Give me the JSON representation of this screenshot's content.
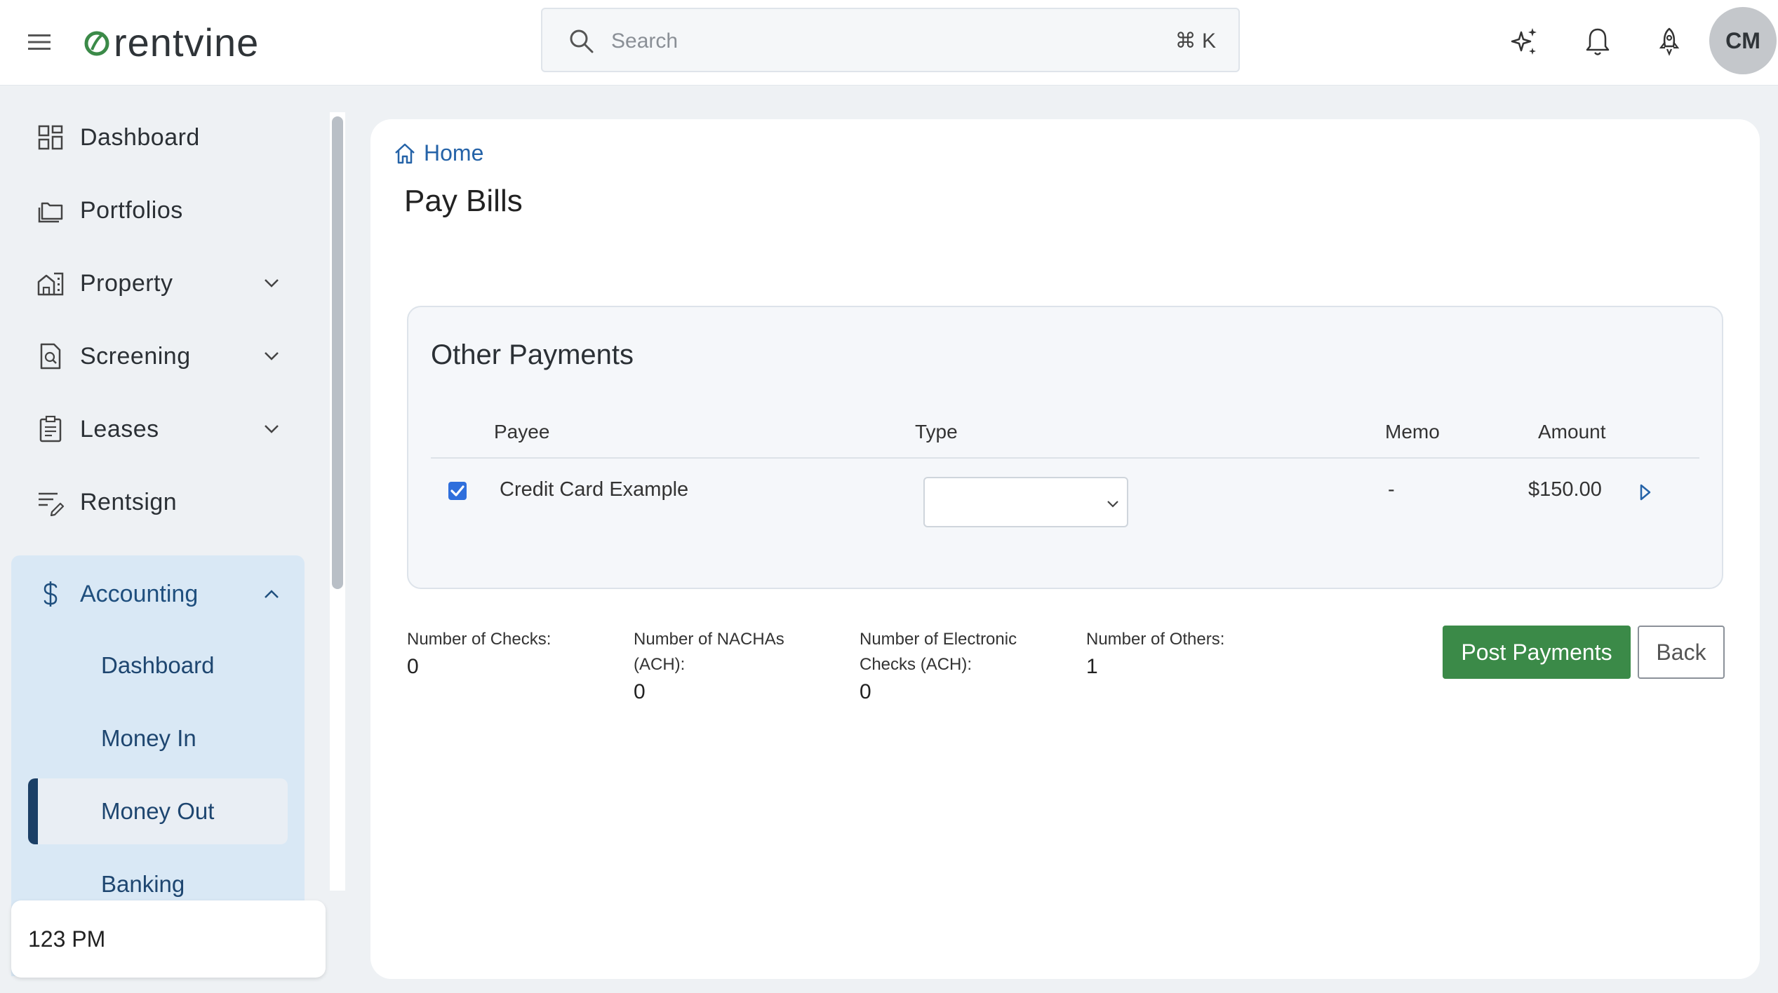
{
  "header": {
    "brand": "rentvine",
    "search_placeholder": "Search",
    "search_shortcut": "⌘ K",
    "avatar_initials": "CM"
  },
  "sidebar": {
    "items": [
      {
        "label": "Dashboard",
        "icon": "dashboard-grid-icon"
      },
      {
        "label": "Portfolios",
        "icon": "folders-icon"
      },
      {
        "label": "Property",
        "icon": "building-icon",
        "expandable": true
      },
      {
        "label": "Screening",
        "icon": "document-search-icon",
        "expandable": true
      },
      {
        "label": "Leases",
        "icon": "clipboard-icon",
        "expandable": true
      },
      {
        "label": "Rentsign",
        "icon": "signature-icon"
      }
    ],
    "accounting": {
      "label": "Accounting",
      "icon": "dollar-icon",
      "expanded": true,
      "sub_items": [
        "Dashboard",
        "Money In",
        "Money Out",
        "Banking"
      ],
      "active": "Money Out"
    },
    "org_name": "123 PM"
  },
  "main": {
    "breadcrumb": "Home",
    "title": "Pay Bills",
    "panel": {
      "title": "Other Payments",
      "columns": {
        "payee": "Payee",
        "type": "Type",
        "memo": "Memo",
        "amount": "Amount"
      },
      "rows": [
        {
          "checked": true,
          "payee": "Credit Card Example",
          "type": "",
          "memo": "-",
          "amount": "$150.00"
        }
      ]
    },
    "stats": [
      {
        "label_line1": "Number of Checks:",
        "label_line2": "",
        "value": "0"
      },
      {
        "label_line1": "Number of NACHAs",
        "label_line2": "(ACH):",
        "value": "0"
      },
      {
        "label_line1": "Number of Electronic",
        "label_line2": "Checks (ACH):",
        "value": "0"
      },
      {
        "label_line1": "Number of Others:",
        "label_line2": "",
        "value": "1"
      }
    ],
    "buttons": {
      "post": "Post Payments",
      "back": "Back"
    }
  },
  "colors": {
    "accent_green": "#3b8a48",
    "link_blue": "#2563a8",
    "nav_active_bg": "#d9e8f5",
    "nav_active_bar": "#1b3f66"
  }
}
